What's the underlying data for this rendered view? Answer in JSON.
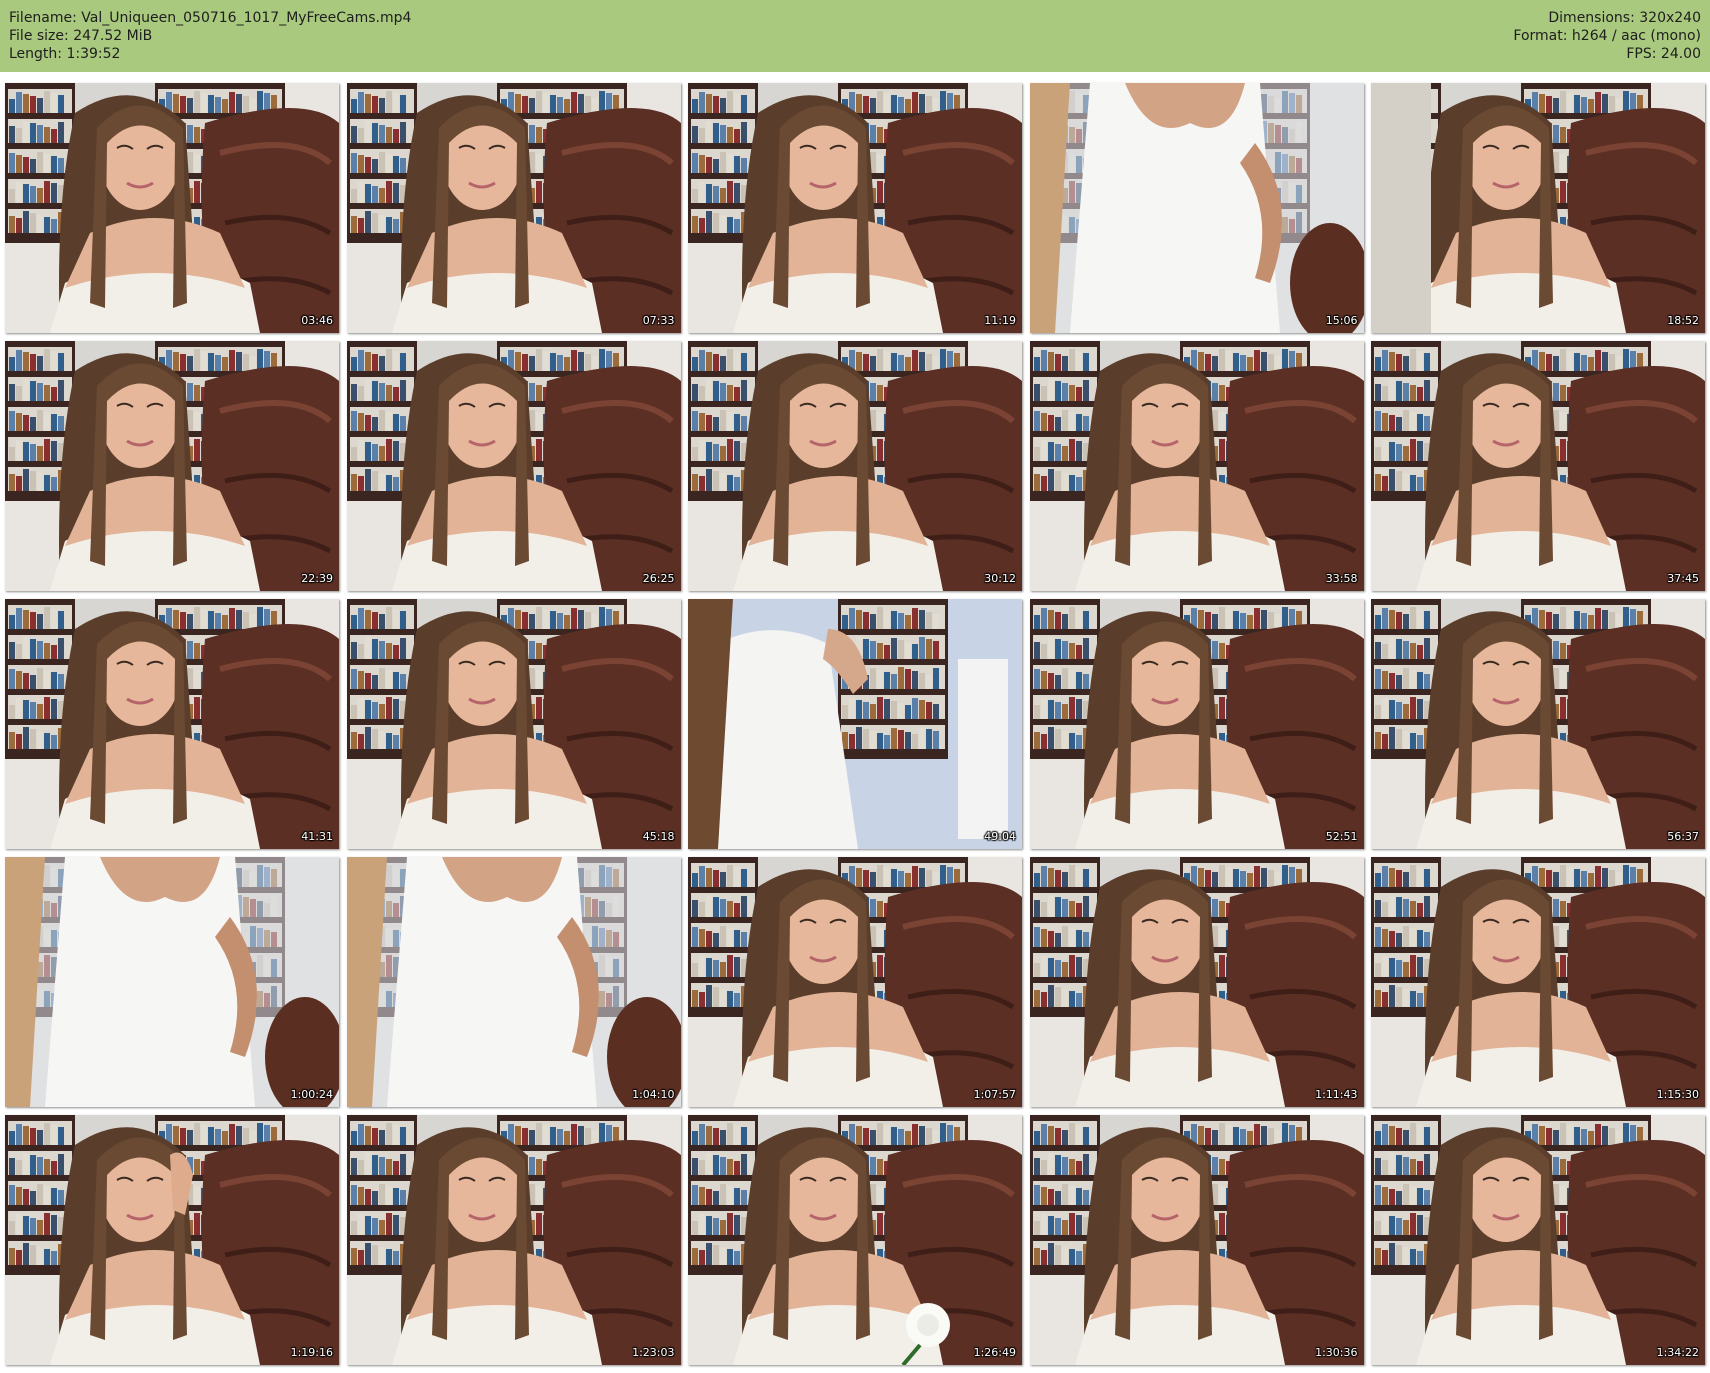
{
  "header": {
    "filename_line": "Filename: Val_Uniqueen_050716_1017_MyFreeCams.mp4",
    "filesize_line": "File size: 247.52 MiB",
    "length_line": "Length: 1:39:52",
    "dimensions_line": "Dimensions: 320x240",
    "format_line": "Format: h264 / aac (mono)",
    "fps_line": "FPS: 24.00"
  },
  "colors": {
    "header_bg": "#a9c97e",
    "page_bg": "#ffffff"
  },
  "thumbnails": [
    {
      "timestamp": "03:46",
      "scene": "seated-chair"
    },
    {
      "timestamp": "07:33",
      "scene": "seated-chair"
    },
    {
      "timestamp": "11:19",
      "scene": "seated-chair"
    },
    {
      "timestamp": "15:06",
      "scene": "standing-dress"
    },
    {
      "timestamp": "18:52",
      "scene": "seated-turned"
    },
    {
      "timestamp": "22:39",
      "scene": "seated-chair"
    },
    {
      "timestamp": "26:25",
      "scene": "seated-chair"
    },
    {
      "timestamp": "30:12",
      "scene": "seated-chair"
    },
    {
      "timestamp": "33:58",
      "scene": "seated-chair"
    },
    {
      "timestamp": "37:45",
      "scene": "seated-chair"
    },
    {
      "timestamp": "41:31",
      "scene": "seated-chair"
    },
    {
      "timestamp": "45:18",
      "scene": "seated-chair"
    },
    {
      "timestamp": "49:04",
      "scene": "standing-room"
    },
    {
      "timestamp": "52:51",
      "scene": "seated-chair"
    },
    {
      "timestamp": "56:37",
      "scene": "seated-chair"
    },
    {
      "timestamp": "1:00:24",
      "scene": "standing-dress"
    },
    {
      "timestamp": "1:04:10",
      "scene": "standing-dress"
    },
    {
      "timestamp": "1:07:57",
      "scene": "seated-chair"
    },
    {
      "timestamp": "1:11:43",
      "scene": "seated-chair"
    },
    {
      "timestamp": "1:15:30",
      "scene": "seated-chair"
    },
    {
      "timestamp": "1:19:16",
      "scene": "seated-hand"
    },
    {
      "timestamp": "1:23:03",
      "scene": "seated-chair"
    },
    {
      "timestamp": "1:26:49",
      "scene": "seated-rose"
    },
    {
      "timestamp": "1:30:36",
      "scene": "seated-chair"
    },
    {
      "timestamp": "1:34:22",
      "scene": "seated-chair"
    }
  ]
}
